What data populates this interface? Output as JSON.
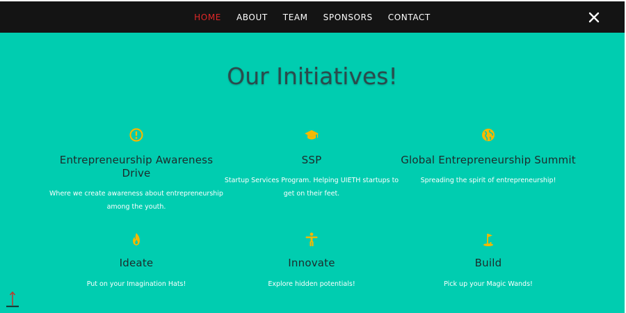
{
  "nav": {
    "items": [
      {
        "label": "HOME",
        "active": true
      },
      {
        "label": "ABOUT",
        "active": false
      },
      {
        "label": "TEAM",
        "active": false
      },
      {
        "label": "SPONSORS",
        "active": false
      },
      {
        "label": "CONTACT",
        "active": false
      }
    ],
    "close_icon": "close-icon"
  },
  "section": {
    "title": "Our Initiatives!"
  },
  "cards": [
    {
      "icon": "alert-circle-icon",
      "title": "Entrepreneurship Awareness Drive",
      "description": "Where we create awareness about entrepreneurship among the youth."
    },
    {
      "icon": "graduation-cap-icon",
      "title": "SSP",
      "description": "Startup Services Program. Helping UIETH startups to get on their feet."
    },
    {
      "icon": "globe-icon",
      "title": "Global Entrepreneurship Summit",
      "description": "Spreading the spirit of entrepreneurship!"
    },
    {
      "icon": "flame-icon",
      "title": "Ideate",
      "description": "Put on your Imagination Hats!"
    },
    {
      "icon": "person-icon",
      "title": "Innovate",
      "description": "Explore hidden potentials!"
    },
    {
      "icon": "golf-flag-icon",
      "title": "Build",
      "description": "Pick up your Magic Wands!"
    }
  ],
  "colors": {
    "background": "#00cdb0",
    "navbar": "#141414",
    "active_nav": "#e02828",
    "icon": "#f5b800",
    "title": "#2b4a4c",
    "scroll_arrow": "#c0392b"
  },
  "scroll_top_icon": "arrow-up-icon"
}
